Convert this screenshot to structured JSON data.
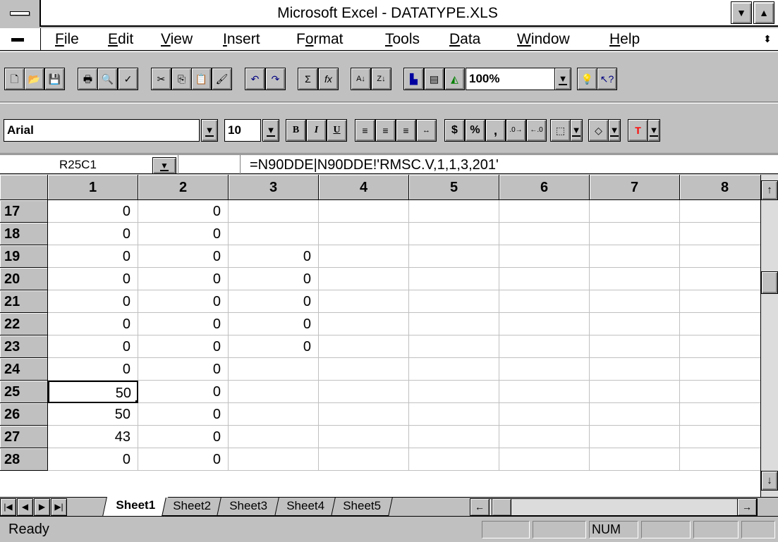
{
  "window": {
    "title": "Microsoft Excel - DATATYPE.XLS",
    "min_glyph": "▼",
    "max_glyph": "▲",
    "restore_glyph": "⬍"
  },
  "menu": [
    "File",
    "Edit",
    "View",
    "Insert",
    "Format",
    "Tools",
    "Data",
    "Window",
    "Help"
  ],
  "menu_underline": [
    "F",
    "E",
    "V",
    "I",
    "o",
    "T",
    "D",
    "W",
    "H"
  ],
  "standard_toolbar": {
    "zoom": "100%"
  },
  "formatting_toolbar": {
    "font": "Arial",
    "size": "10",
    "bold": "B",
    "italic": "I",
    "underline": "U",
    "currency": "$",
    "percent": "%",
    "comma": ","
  },
  "formula_bar": {
    "name_box": "R25C1",
    "formula": "=N90DDE|N90DDE!'RMSC.V,1,1,3,201'"
  },
  "grid": {
    "columns": [
      "1",
      "2",
      "3",
      "4",
      "5",
      "6",
      "7",
      "8"
    ],
    "rows": [
      {
        "num": "17",
        "cells": [
          "0",
          "0",
          "",
          "",
          "",
          "",
          "",
          ""
        ]
      },
      {
        "num": "18",
        "cells": [
          "0",
          "0",
          "",
          "",
          "",
          "",
          "",
          ""
        ]
      },
      {
        "num": "19",
        "cells": [
          "0",
          "0",
          "0",
          "",
          "",
          "",
          "",
          ""
        ]
      },
      {
        "num": "20",
        "cells": [
          "0",
          "0",
          "0",
          "",
          "",
          "",
          "",
          ""
        ]
      },
      {
        "num": "21",
        "cells": [
          "0",
          "0",
          "0",
          "",
          "",
          "",
          "",
          ""
        ]
      },
      {
        "num": "22",
        "cells": [
          "0",
          "0",
          "0",
          "",
          "",
          "",
          "",
          ""
        ]
      },
      {
        "num": "23",
        "cells": [
          "0",
          "0",
          "0",
          "",
          "",
          "",
          "",
          ""
        ]
      },
      {
        "num": "24",
        "cells": [
          "0",
          "0",
          "",
          "",
          "",
          "",
          "",
          ""
        ]
      },
      {
        "num": "25",
        "cells": [
          "50",
          "0",
          "",
          "",
          "",
          "",
          "",
          ""
        ]
      },
      {
        "num": "26",
        "cells": [
          "50",
          "0",
          "",
          "",
          "",
          "",
          "",
          ""
        ]
      },
      {
        "num": "27",
        "cells": [
          "43",
          "0",
          "",
          "",
          "",
          "",
          "",
          ""
        ]
      },
      {
        "num": "28",
        "cells": [
          "0",
          "0",
          "",
          "",
          "",
          "",
          "",
          ""
        ]
      }
    ],
    "active_row": "25",
    "active_col": "1"
  },
  "sheets": {
    "tabs": [
      "Sheet1",
      "Sheet2",
      "Sheet3",
      "Sheet4",
      "Sheet5"
    ],
    "active": "Sheet1"
  },
  "status": {
    "text": "Ready",
    "num": "NUM"
  }
}
